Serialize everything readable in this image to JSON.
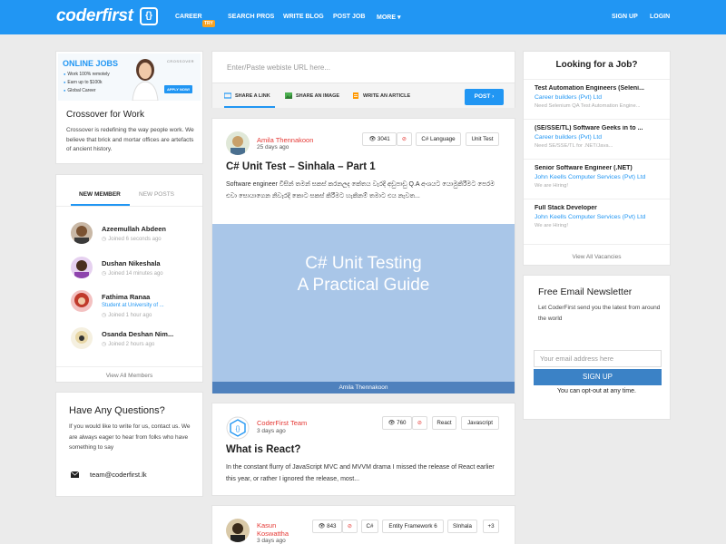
{
  "brand": {
    "logo": "coderfirst",
    "logo_mark": "{}"
  },
  "nav": {
    "left": [
      "CAREER",
      "SEARCH PROS",
      "WRITE BLOG",
      "POST JOB",
      "MORE ▾"
    ],
    "career_badge": "TRY",
    "right": [
      "SIGN UP",
      "LOGIN"
    ]
  },
  "ad": {
    "headline": "ONLINE JOBS",
    "lines": [
      "Work 100% remotely",
      "Earn up to $100k",
      "Global Career"
    ],
    "brand": "CROSSOVER",
    "apply": "APPLY NOW!",
    "title": "Crossover for Work",
    "description": "Crossover is redefining the way people work. We believe that brick and mortar offices are artefacts of ancient history."
  },
  "members": {
    "tabs": [
      "NEW MEMBER",
      "NEW POSTS"
    ],
    "list": [
      {
        "name": "Azeemullah Abdeen",
        "lines": [
          {
            "text": "Joined 6 seconds ago",
            "style": "grey"
          }
        ]
      },
      {
        "name": "Dushan Nikeshala",
        "lines": [
          {
            "text": "Joined 14 minutes ago",
            "style": "grey"
          }
        ]
      },
      {
        "name": "Fathima Ranaa",
        "lines": [
          {
            "text": "Student at University of ...",
            "style": "blue"
          },
          {
            "text": "Joined 1 hour ago",
            "style": "grey"
          }
        ]
      },
      {
        "name": "Osanda Deshan Nim...",
        "lines": [
          {
            "text": "Joined 2 hours ago",
            "style": "grey"
          }
        ]
      }
    ],
    "view_all": "View All Members"
  },
  "questions": {
    "title": "Have Any Questions?",
    "description": "If you would like to write for us, contact us. We are always eager to hear from folks who have something to say",
    "email": "team@coderfirst.lk"
  },
  "share": {
    "placeholder": "Enter/Paste webiste URL here...",
    "options": [
      "SHARE A LINK",
      "SHARE AN IMAGE",
      "WRITE AN ARTICLE"
    ],
    "post_button": "POST ›"
  },
  "posts": [
    {
      "author": "Amila Thennakoon",
      "date": "25 days ago",
      "views": "3041",
      "tags": [
        "C# Language",
        "Unit Test"
      ],
      "title": "C# Unit Test – Sinhala – Part 1",
      "excerpt": "Software engineer විසින් තමන් සකස් කරනලද කේතය වැරදි අඩුපාඩු Q.A අංශයට යොමුකිරීමට පෙරම එවා සොයාගෙන නිවැරදි කොට සකස් කිරීමට හැකිනම් තමාට එය නැවත...",
      "image_lines": [
        "C# Unit Testing",
        "A Practical Guide"
      ],
      "image_footer": "Amila Thennakoon"
    },
    {
      "author": "CoderFirst Team",
      "date": "3 days ago",
      "views": "760",
      "tags": [
        "React",
        "Javascript"
      ],
      "title": "What is React?",
      "excerpt": "In the constant flurry of JavaScript MVC and MVVM drama I missed the release of React earlier this year, or rather I ignored the release, most..."
    },
    {
      "author": "Kasun Koswattha",
      "date": "3 days ago",
      "views": "843",
      "tags": [
        "C#",
        "Entity Framework 6",
        "SInhala",
        "+3"
      ]
    }
  ],
  "jobs": {
    "title": "Looking for a Job?",
    "list": [
      {
        "title": "Test Automation Engineers (Seleni...",
        "company": "Career builders (Pvt) Ltd",
        "desc": "Need Selenium QA Test Automation Engine..."
      },
      {
        "title": "(SE/SSE/TL) Software Geeks in to ...",
        "company": "Career builders (Pvt) Ltd",
        "desc": "Need SE/SSE/TL for .NET/Java..."
      },
      {
        "title": "Senior Software Engineer (.NET)",
        "company": "John Keells Computer Services (Pvt) Ltd",
        "desc": "We are Hiring!"
      },
      {
        "title": "Full Stack Developer",
        "company": "John Keells Computer Services (Pvt) Ltd",
        "desc": "We are Hiring!"
      }
    ],
    "view_all": "View All Vacancies"
  },
  "newsletter": {
    "title": "Free Email Newsletter",
    "description": "Let CoderFirst send you the latest from around the world",
    "placeholder": "Your email address here",
    "button": "SIGN UP",
    "opt_out": "You can opt-out at any time."
  },
  "colors": {
    "primary": "#2196f3",
    "author": "#e53935",
    "badge": "#f7a221"
  }
}
